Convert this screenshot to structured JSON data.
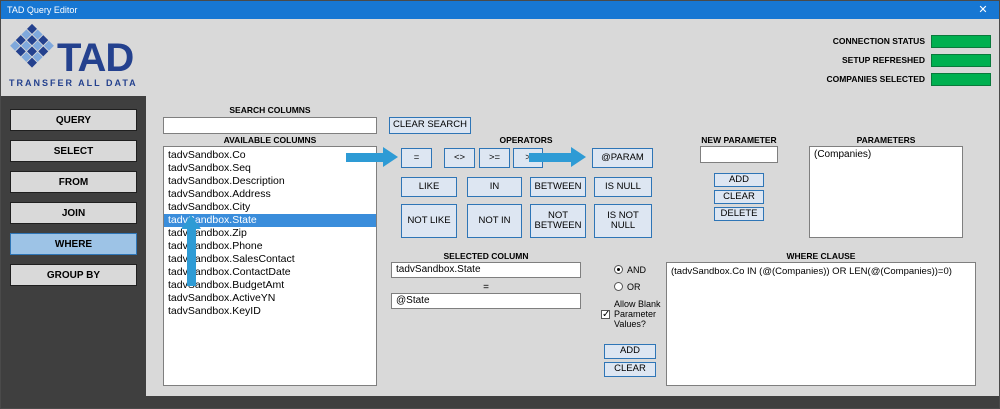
{
  "window": {
    "title": "TAD Query Editor",
    "close_glyph": "✕"
  },
  "logo": {
    "text": "TAD",
    "subtext": "TRANSFER ALL DATA"
  },
  "status_panel": {
    "items": [
      {
        "label": "CONNECTION STATUS"
      },
      {
        "label": "SETUP REFRESHED"
      },
      {
        "label": "COMPANIES SELECTED"
      }
    ],
    "indicator_color": "#00b050"
  },
  "sidebar": {
    "items": [
      {
        "label": "QUERY"
      },
      {
        "label": "SELECT"
      },
      {
        "label": "FROM"
      },
      {
        "label": "JOIN"
      },
      {
        "label": "WHERE"
      },
      {
        "label": "GROUP BY"
      }
    ],
    "active": "WHERE"
  },
  "search": {
    "label": "SEARCH COLUMNS",
    "value": "",
    "clear_button": "CLEAR SEARCH"
  },
  "columns": {
    "label": "AVAILABLE COLUMNS",
    "items": [
      "tadvSandbox.Co",
      "tadvSandbox.Seq",
      "tadvSandbox.Description",
      "tadvSandbox.Address",
      "tadvSandbox.City",
      "tadvSandbox.State",
      "tadvSandbox.Zip",
      "tadvSandbox.Phone",
      "tadvSandbox.SalesContact",
      "tadvSandbox.ContactDate",
      "tadvSandbox.BudgetAmt",
      "tadvSandbox.ActiveYN",
      "tadvSandbox.KeyID"
    ],
    "selected": "tadvSandbox.State"
  },
  "operators": {
    "label": "OPERATORS",
    "row1": [
      "=",
      "<>",
      ">=",
      ">"
    ],
    "param_button": "@PARAM",
    "row2": [
      "LIKE",
      "IN",
      "BETWEEN",
      "IS NULL"
    ],
    "row3": [
      "NOT LIKE",
      "NOT IN",
      "NOT BETWEEN",
      "IS NOT NULL"
    ]
  },
  "new_parameter": {
    "label": "NEW PARAMETER",
    "value": "",
    "add_button": "ADD",
    "clear_button": "CLEAR",
    "delete_button": "DELETE"
  },
  "parameters": {
    "label": "PARAMETERS",
    "items": [
      "(Companies)"
    ]
  },
  "selected_column": {
    "label": "SELECTED COLUMN",
    "column": "tadvSandbox.State",
    "operator": "=",
    "value": "@State"
  },
  "connector": {
    "and_label": "AND",
    "or_label": "OR",
    "selected": "AND"
  },
  "blank_values": {
    "label": "Allow Blank Parameter Values?",
    "checked": true
  },
  "where_actions": {
    "add_button": "ADD",
    "clear_button": "CLEAR"
  },
  "where_clause": {
    "label": "WHERE CLAUSE",
    "value": "(tadvSandbox.Co IN (@(Companies)) OR LEN(@(Companies))=0)"
  },
  "colors": {
    "titlebar_blue": "#1777d3",
    "accent_blue": "#2e75b6",
    "arrow_blue": "#2e9bd5",
    "status_green": "#00b050",
    "selection_blue": "#3a8ddb",
    "sidebar_gray": "#3f3f3f"
  }
}
